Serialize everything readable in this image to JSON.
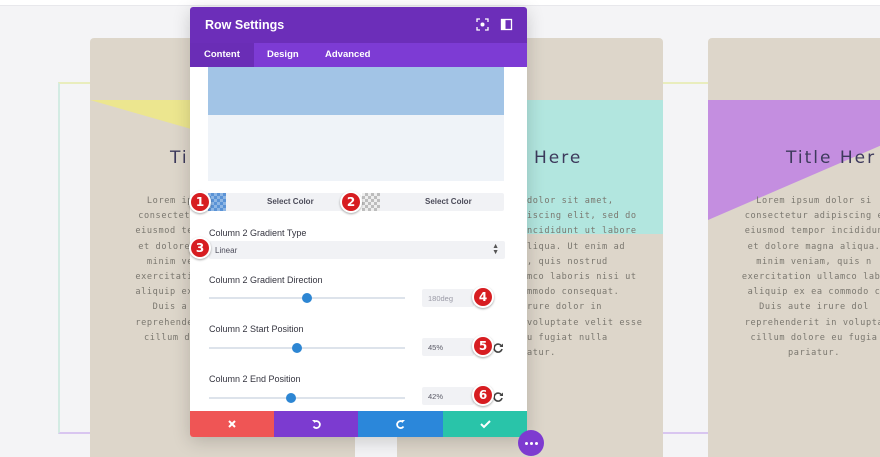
{
  "background": {
    "cards": [
      {
        "title": "Ti",
        "text": "Lorem ip\nconsectetur\neiusmod temp\net dolore m\nminim ve\nexercitation\naliquip ex e\nDuis a\nreprehenderi\ncillum do",
        "shape_color": "#ece68f"
      },
      {
        "title": "Here",
        "text": "dolor sit amet,\niscing elit, sed do\nncididunt ut labore\nliqua. Ut enim ad\n, quis nostrud\nmco laboris nisi ut\nmmodo consequat.\nrure dolor in\nvoluptate velit esse\nu fugiat nulla\natur.",
        "shape_color": "#b2e6df"
      },
      {
        "title": "Title Her",
        "text": "Lorem ipsum dolor si\nconsectetur adipiscing e\neiusmod tempor incididun\net dolore magna aliqua.\nminim veniam, quis n\nexercitation ullamco labo\naliquip ex ea commodo c\nDuis aute irure dol\nreprehenderit in volupta\ncillum dolore eu fugia\npariatur.",
        "shape_color": "#c48ee0"
      }
    ]
  },
  "modal": {
    "title": "Row Settings",
    "header_icons": [
      "focus-icon",
      "sidebar-toggle-icon"
    ],
    "tabs": [
      {
        "label": "Content",
        "active": true
      },
      {
        "label": "Design",
        "active": false
      },
      {
        "label": "Advanced",
        "active": false
      }
    ],
    "gradient_preview_color": "#a2c4e6",
    "color_pickers": [
      {
        "label": "Select Color",
        "swatch_color": "#8eb6e4"
      },
      {
        "label": "Select Color",
        "swatch_color": "transparent"
      }
    ],
    "gradient_type": {
      "label": "Column 2 Gradient Type",
      "value": "Linear"
    },
    "gradient_direction": {
      "label": "Column 2 Gradient Direction",
      "value": "180deg",
      "level_percent": 50
    },
    "start_position": {
      "label": "Column 2 Start Position",
      "value": "45%",
      "level_percent": 45
    },
    "end_position": {
      "label": "Column 2 End Position",
      "value": "42%",
      "level_percent": 42
    },
    "footer_buttons": [
      {
        "name": "discard",
        "icon": "close-icon",
        "color": "#ef5555"
      },
      {
        "name": "undo",
        "icon": "undo-icon",
        "color": "#7c3bd0"
      },
      {
        "name": "redo",
        "icon": "redo-icon",
        "color": "#2b87da"
      },
      {
        "name": "save",
        "icon": "check-icon",
        "color": "#29c4a9"
      }
    ]
  },
  "annotations": [
    "1",
    "2",
    "3",
    "4",
    "5",
    "6"
  ],
  "colors": {
    "header": "#6c2eb9",
    "tabs": "#7d3bd4",
    "slider": "#2d86d3",
    "badge": "#d71d21",
    "card": "#ddd6ca"
  }
}
